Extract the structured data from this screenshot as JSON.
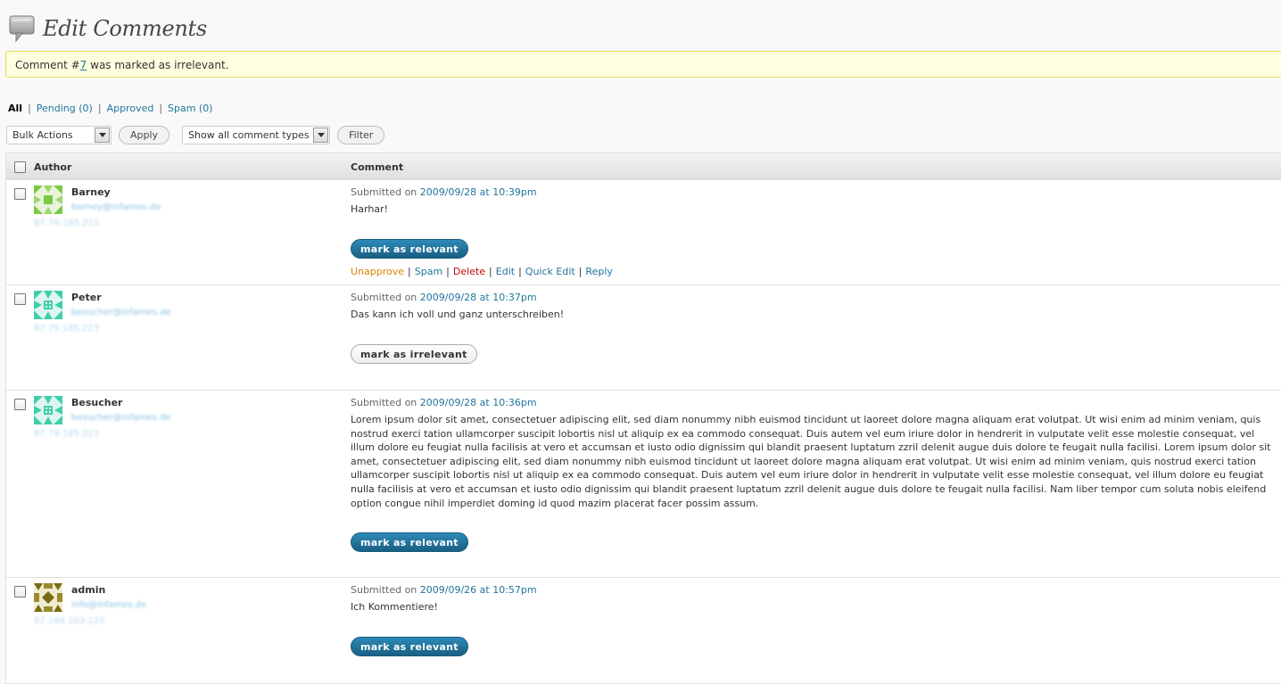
{
  "header": {
    "title": "Edit Comments",
    "icon": "comments-bubble-icon"
  },
  "notice": {
    "prefix": "Comment #",
    "comment_number": "7",
    "suffix": " was marked as irrelevant."
  },
  "filters": {
    "all": "All",
    "pending": "Pending (0)",
    "approved": "Approved",
    "spam": "Spam (0)"
  },
  "controls": {
    "bulk_actions": "Bulk Actions",
    "apply": "Apply",
    "comment_types": "Show all comment types",
    "filter": "Filter"
  },
  "table": {
    "col_author": "Author",
    "col_comment": "Comment"
  },
  "comments": [
    {
      "author": "Barney",
      "email": "barney@infames.de",
      "ip": "87.79.185.223",
      "submitted_prefix": "Submitted on ",
      "date": "2009/09/28 at 10:39pm",
      "text": "Harhar!",
      "button": "mark as relevant",
      "button_style": "primary",
      "actions": {
        "unapprove": "Unapprove",
        "spam": "Spam",
        "delete": "Delete",
        "edit": "Edit",
        "quick_edit": "Quick Edit",
        "reply": "Reply"
      },
      "avatar_color": "#7cc844"
    },
    {
      "author": "Peter",
      "email": "besucher@infames.de",
      "ip": "87.79.185.223",
      "submitted_prefix": "Submitted on ",
      "date": "2009/09/28 at 10:37pm",
      "text": "Das kann ich voll und ganz unterschreiben!",
      "button": "mark as irrelevant",
      "button_style": "plain",
      "avatar_color": "#3fcfa8"
    },
    {
      "author": "Besucher",
      "email": "besucher@infames.de",
      "ip": "87.79.185.223",
      "submitted_prefix": "Submitted on ",
      "date": "2009/09/28 at 10:36pm",
      "text": "Lorem ipsum dolor sit amet, consectetuer adipiscing elit, sed diam nonummy nibh euismod tincidunt ut laoreet dolore magna aliquam erat volutpat. Ut wisi enim ad minim veniam, quis nostrud exerci tation ullamcorper suscipit lobortis nisl ut aliquip ex ea commodo consequat. Duis autem vel eum iriure dolor in hendrerit in vulputate velit esse molestie consequat, vel illum dolore eu feugiat nulla facilisis at vero et accumsan et iusto odio dignissim qui blandit praesent luptatum zzril delenit augue duis dolore te feugait nulla facilisi. Lorem ipsum dolor sit amet, consectetuer adipiscing elit, sed diam nonummy nibh euismod tincidunt ut laoreet dolore magna aliquam erat volutpat. Ut wisi enim ad minim veniam, quis nostrud exerci tation ullamcorper suscipit lobortis nisl ut aliquip ex ea commodo consequat. Duis autem vel eum iriure dolor in hendrerit in vulputate velit esse molestie consequat, vel illum dolore eu feugiat nulla facilisis at vero et accumsan et iusto odio dignissim qui blandit praesent luptatum zzril delenit augue duis dolore te feugait nulla facilisi. Nam liber tempor cum soluta nobis eleifend option congue nihil imperdiet doming id quod mazim placerat facer possim assum.",
      "button": "mark as relevant",
      "button_style": "primary",
      "avatar_color": "#3fcfa8"
    },
    {
      "author": "admin",
      "email": "info@infames.de",
      "ip": "87.186.103.222",
      "submitted_prefix": "Submitted on ",
      "date": "2009/09/26 at 10:57pm",
      "text": "Ich Kommentiere!",
      "button": "mark as relevant",
      "button_style": "primary",
      "avatar_color": "#7a6a14"
    }
  ]
}
